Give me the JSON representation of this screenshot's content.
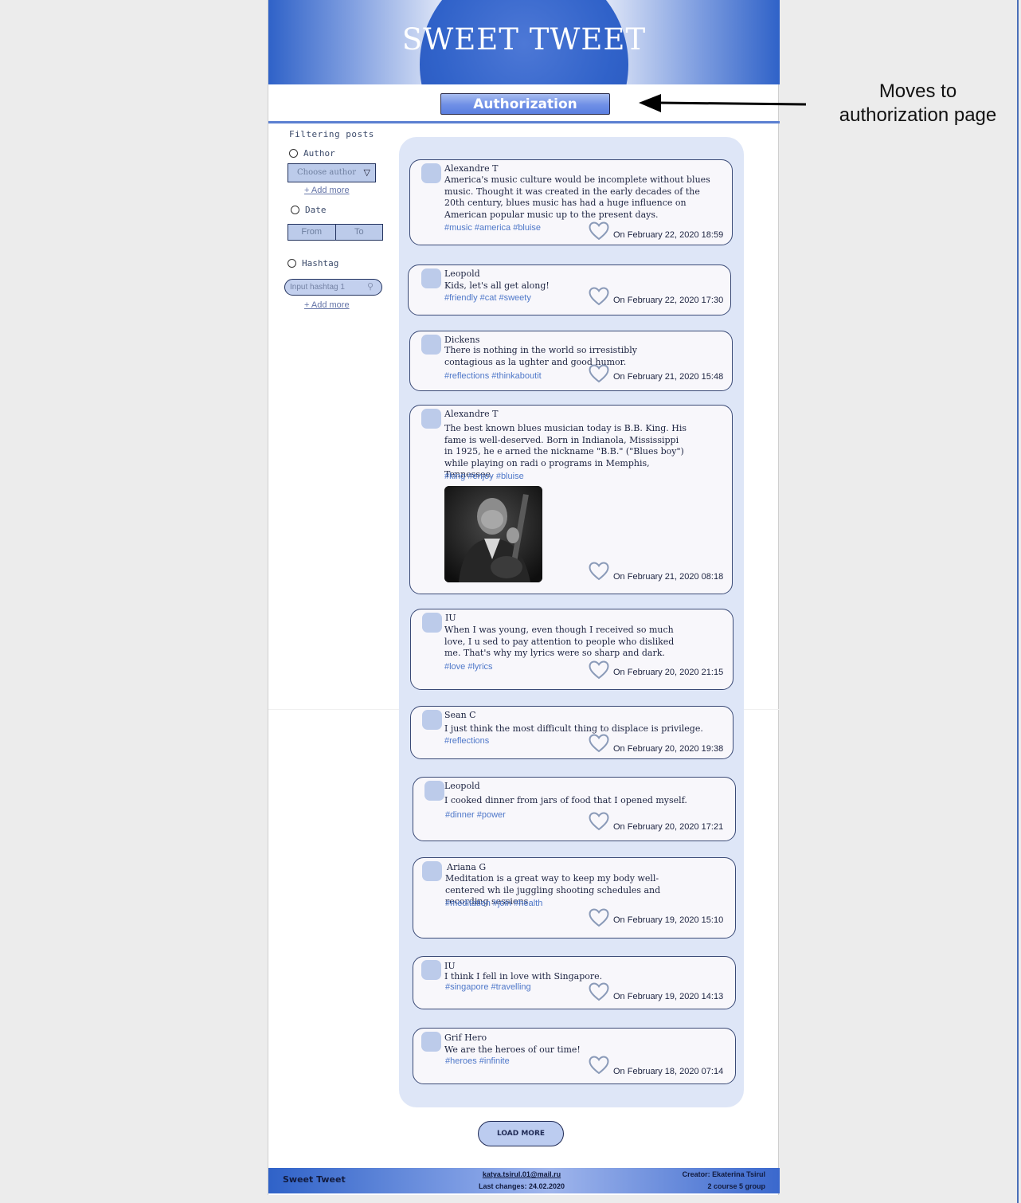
{
  "header": {
    "title": "SWEET TWEET",
    "auth_button": "Authorization"
  },
  "annotation": {
    "text": "Moves to authorization page"
  },
  "sidebar": {
    "title": "Filtering posts",
    "author_label": "Author",
    "author_select": "Choose author",
    "add_more_1": "+ Add more",
    "date_label": "Date",
    "date_from": "From",
    "date_to": "To",
    "hashtag_label": "Hashtag",
    "hashtag_placeholder": "Input hashtag 1",
    "add_more_2": "+ Add more"
  },
  "posts": [
    {
      "author": "Alexandre T",
      "text": "America's music culture would be incomplete without blues music. Thought it was created in the early decades of the 20th century, blues music has had a huge influence on American popular music up to the present days.",
      "tags": "#music #america #bluise",
      "date": "On February 22, 2020 18:59"
    },
    {
      "author": "Leopold",
      "text": "Kids, let's all get along!",
      "tags": "#friendly #cat #sweety",
      "date": "On February 22, 2020 17:30"
    },
    {
      "author": "Dickens",
      "text": "There is nothing in the world so irresistibly contagious as la ughter and good humor.",
      "tags": "#reflections #thinkaboutit",
      "date": "On February 21, 2020 15:48"
    },
    {
      "author": "Alexandre T",
      "text": "The best known blues musician today is B.B. King. His fame is well-deserved. Born in Indianola, Mississippi in 1925, he e arned the nickname \"B.B.\" (\"Blues boy\") while playing on radi o programs in Memphis, Tennessee.",
      "tags": "#king #enjoy #bluise",
      "date": "On February 21, 2020 08:18"
    },
    {
      "author": "IU",
      "text": "When I was young, even though I received so much love, I u sed to pay attention to people who disliked me. That's why my lyrics were so sharp and dark.",
      "tags": "#love #lyrics",
      "date": "On February 20, 2020 21:15"
    },
    {
      "author": "Sean C",
      "text": "I just think the most difficult thing to displace is privilege.",
      "tags": "#reflections",
      "date": "On February 20, 2020 19:38"
    },
    {
      "author": "Leopold",
      "text": "I cooked dinner from jars of food that I opened myself.",
      "tags": "#dinner #power",
      "date": "On February 20, 2020 17:21"
    },
    {
      "author": "Ariana G",
      "text": "Meditation is a great way to keep my body well-centered wh ile juggling shooting schedules and recording sessions.",
      "tags": "#meditation #join #health",
      "date": "On February 19, 2020 15:10"
    },
    {
      "author": "IU",
      "text": "I think I fell in love with Singapore.",
      "tags": "#singapore #travelling",
      "date": "On February 19, 2020 14:13"
    },
    {
      "author": "Grif Hero",
      "text": "We are the heroes of our time!",
      "tags": "#heroes #infinite",
      "date": "On February 18, 2020 07:14"
    }
  ],
  "load_more": "LOAD MORE",
  "footer": {
    "brand": "Sweet Tweet",
    "email": "katya.tsirul.01@mail.ru",
    "last_changes": "Last changes: 24.02.2020",
    "creator": "Creator: Ekaterina Tsirul",
    "group": "2 course 5 group"
  },
  "colors": {
    "accent": "#3062c9",
    "feed_bg": "#dee6f7",
    "tag": "#4f78c9"
  }
}
